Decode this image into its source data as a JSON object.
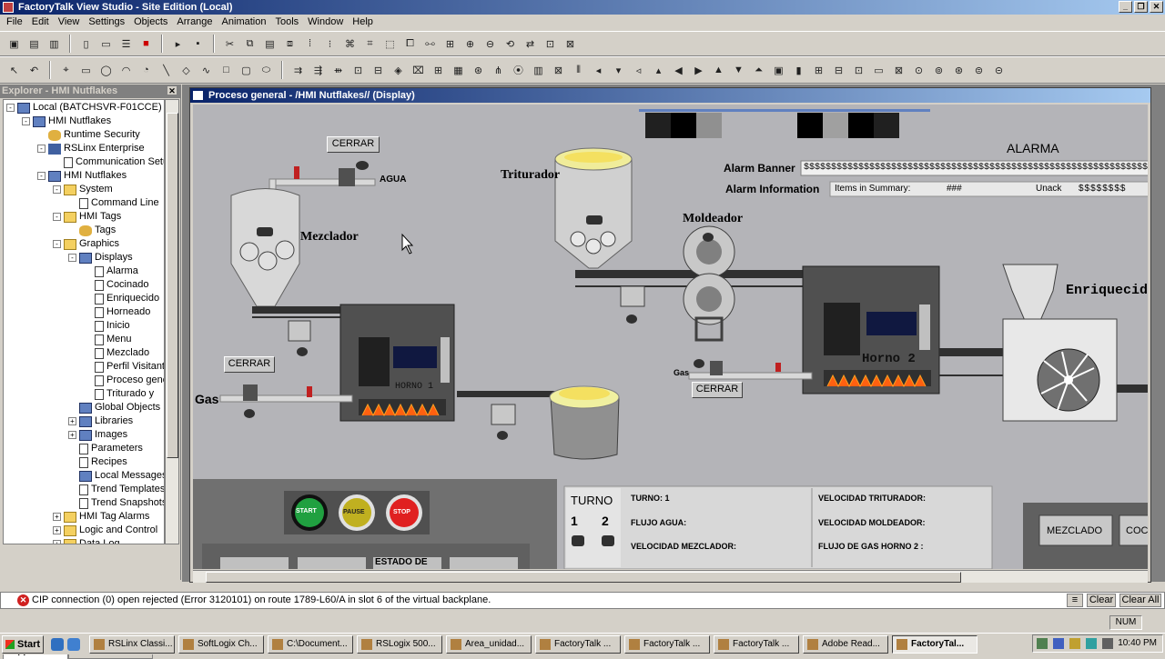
{
  "app": {
    "title": "FactoryTalk View Studio - Site Edition (Local)"
  },
  "menu": [
    "File",
    "Edit",
    "View",
    "Settings",
    "Objects",
    "Arrange",
    "Animation",
    "Tools",
    "Window",
    "Help"
  ],
  "explorer": {
    "title": "Explorer - HMI Nutflakes",
    "tree": [
      {
        "label": "Local (BATCHSVR-F01CCE)",
        "level": 0,
        "exp": "-",
        "icon": "comp"
      },
      {
        "label": "HMI Nutflakes",
        "level": 1,
        "exp": "-",
        "icon": "comp"
      },
      {
        "label": "Runtime Security",
        "level": 2,
        "exp": "",
        "icon": "key"
      },
      {
        "label": "RSLinx Enterprise",
        "level": 2,
        "exp": "-",
        "icon": "net"
      },
      {
        "label": "Communication Setup",
        "level": 3,
        "exp": "",
        "icon": "doc"
      },
      {
        "label": "HMI Nutflakes",
        "level": 2,
        "exp": "-",
        "icon": "comp"
      },
      {
        "label": "System",
        "level": 3,
        "exp": "-",
        "icon": "folder"
      },
      {
        "label": "Command Line",
        "level": 4,
        "exp": "",
        "icon": "doc"
      },
      {
        "label": "HMI Tags",
        "level": 3,
        "exp": "-",
        "icon": "folder"
      },
      {
        "label": "Tags",
        "level": 4,
        "exp": "",
        "icon": "key"
      },
      {
        "label": "Graphics",
        "level": 3,
        "exp": "-",
        "icon": "folder"
      },
      {
        "label": "Displays",
        "level": 4,
        "exp": "-",
        "icon": "comp"
      },
      {
        "label": "Alarma",
        "level": 5,
        "exp": "",
        "icon": "doc"
      },
      {
        "label": "Cocinado",
        "level": 5,
        "exp": "",
        "icon": "doc"
      },
      {
        "label": "Enriquecido",
        "level": 5,
        "exp": "",
        "icon": "doc"
      },
      {
        "label": "Horneado",
        "level": 5,
        "exp": "",
        "icon": "doc"
      },
      {
        "label": "Inicio",
        "level": 5,
        "exp": "",
        "icon": "doc"
      },
      {
        "label": "Menu",
        "level": 5,
        "exp": "",
        "icon": "doc"
      },
      {
        "label": "Mezclado",
        "level": 5,
        "exp": "",
        "icon": "doc"
      },
      {
        "label": "Perfil Visitante",
        "level": 5,
        "exp": "",
        "icon": "doc"
      },
      {
        "label": "Proceso general",
        "level": 5,
        "exp": "",
        "icon": "doc"
      },
      {
        "label": "Triturado y",
        "level": 5,
        "exp": "",
        "icon": "doc"
      },
      {
        "label": "Global Objects",
        "level": 4,
        "exp": "",
        "icon": "comp"
      },
      {
        "label": "Libraries",
        "level": 4,
        "exp": "+",
        "icon": "comp"
      },
      {
        "label": "Images",
        "level": 4,
        "exp": "+",
        "icon": "comp"
      },
      {
        "label": "Parameters",
        "level": 4,
        "exp": "",
        "icon": "doc"
      },
      {
        "label": "Recipes",
        "level": 4,
        "exp": "",
        "icon": "doc"
      },
      {
        "label": "Local Messages",
        "level": 4,
        "exp": "",
        "icon": "comp"
      },
      {
        "label": "Trend Templates",
        "level": 4,
        "exp": "",
        "icon": "doc"
      },
      {
        "label": "Trend Snapshots",
        "level": 4,
        "exp": "",
        "icon": "doc"
      },
      {
        "label": "HMI Tag Alarms",
        "level": 3,
        "exp": "+",
        "icon": "folder"
      },
      {
        "label": "Logic and Control",
        "level": 3,
        "exp": "+",
        "icon": "folder"
      },
      {
        "label": "Data Log",
        "level": 3,
        "exp": "+",
        "icon": "folder"
      }
    ],
    "tabs": [
      "Application",
      "Communications"
    ]
  },
  "display": {
    "title": "Proceso general - /HMI Nutflakes// (Display)",
    "labels": {
      "agua": "AGUA",
      "mezclador": "Mezclador",
      "triturador": "Triturador",
      "moldeador": "Moldeador",
      "enriquecido": "Enriquecido",
      "gas_left": "Gas",
      "gas_right": "Gas",
      "horno1": "HORNO 1",
      "horno2": "Horno 2"
    },
    "buttons": {
      "cerrar1": "CERRAR",
      "cerrar2": "CERRAR",
      "cerrar3": "CERRAR"
    },
    "alarm": {
      "title": "ALARMA",
      "banner_label": "Alarm Banner",
      "banner_value": "$$$$$$$$$$$$$$$$$$$$$$$$$$$$$$$$$$$$$$$$$$$$$$$$$$$$$$$$$$$$$$$$$$$$$$$$$$$$$$$$$$$$$$$$$$",
      "info_label": "Alarm Information",
      "items_label": "Items in Summary:",
      "items_value": "###",
      "unack_label": "Unack",
      "unack_value": "$$$$$$$$"
    },
    "controls": {
      "start": "START",
      "pause": "PAUSE",
      "stop": "STOP"
    },
    "turno": {
      "title": "TURNO",
      "one": "1",
      "two": "2"
    },
    "info": {
      "turno": "TURNO: 1",
      "flujo_agua": "FLUJO AGUA:",
      "vel_mezclador": "VELOCIDAD MEZCLADOR:",
      "vel_triturador": "VELOCIDAD TRITURADOR:",
      "vel_moldeador": "VELOCIDAD MOLDEADOR:",
      "flujo_gas": "FLUJO DE GAS HORNO 2 :"
    },
    "nav": {
      "mezclado": "MEZCLADO",
      "coc": "COC",
      "estado": "ESTADO DE"
    }
  },
  "message": {
    "text": "CIP connection (0) open rejected (Error 3120101) on route 1789-L60/A in slot 6 of the virtual backplane.",
    "clear": "Clear",
    "clear_all": "Clear All"
  },
  "status": {
    "num": "NUM"
  },
  "taskbar": {
    "start": "Start",
    "tasks": [
      "RSLinx Classi...",
      "SoftLogix Ch...",
      "C:\\Document...",
      "RSLogix 500...",
      "Area_unidad...",
      "FactoryTalk ...",
      "FactoryTalk ...",
      "FactoryTalk ...",
      "Adobe Read...",
      "FactoryTal..."
    ],
    "clock": "10:40 PM"
  }
}
